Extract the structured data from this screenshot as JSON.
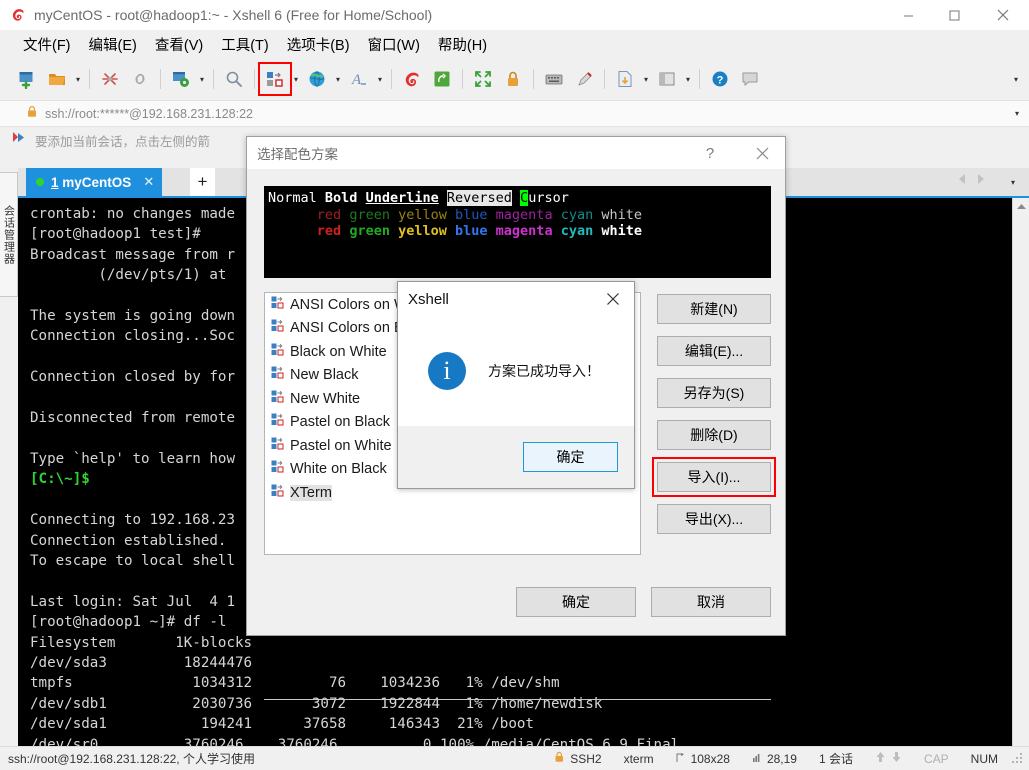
{
  "window": {
    "title": "myCentOS - root@hadoop1:~ - Xshell 6 (Free for Home/School)",
    "minimize": "−",
    "maximize": "□",
    "close": "✕"
  },
  "menubar": {
    "items": [
      {
        "label": "文件(F)",
        "name": "menu-file"
      },
      {
        "label": "编辑(E)",
        "name": "menu-edit"
      },
      {
        "label": "查看(V)",
        "name": "menu-view"
      },
      {
        "label": "工具(T)",
        "name": "menu-tools"
      },
      {
        "label": "选项卡(B)",
        "name": "menu-tabs"
      },
      {
        "label": "窗口(W)",
        "name": "menu-window"
      },
      {
        "label": "帮助(H)",
        "name": "menu-help"
      }
    ]
  },
  "toolbar": {
    "overflow_caret": "▾",
    "items": [
      "new-session-icon",
      "open-folder-icon",
      "dropdown-caret",
      "separator",
      "disconnect-icon",
      "link-icon",
      "separator",
      "properties-icon",
      "dropdown-caret",
      "separator",
      "find-icon",
      "separator",
      "color-scheme-icon",
      "dropdown-caret",
      "globe-icon",
      "dropdown-caret",
      "font-icon",
      "dropdown-caret",
      "separator",
      "xshell-icon",
      "xftp-icon",
      "separator",
      "fullscreen-icon",
      "lock-icon",
      "separator",
      "keyboard-icon",
      "highlight-icon",
      "separator",
      "transfer-icon",
      "dropdown-caret",
      "layout-icon",
      "dropdown-caret",
      "separator",
      "help-icon",
      "feedback-icon"
    ]
  },
  "address_bar": {
    "value": "ssh://root:******@192.168.231.128:22",
    "caret": "▾"
  },
  "hint_bar": {
    "text": "要添加当前会话，点击左侧的箭"
  },
  "session_strip": {
    "label": "会话管理器"
  },
  "tabbar": {
    "tab_index": "1",
    "tab_label": "myCentOS",
    "tab_close": "✕",
    "add_label": "+",
    "nav_left": "◀",
    "nav_right": "▶",
    "menu_caret": "▾"
  },
  "terminal": {
    "lines": [
      "crontab: no changes made",
      "[root@hadoop1 test]#",
      "Broadcast message from r",
      "        (/dev/pts/1) at",
      "",
      "The system is going down",
      "Connection closing...Soc",
      "",
      "Connection closed by for",
      "",
      "Disconnected from remote",
      "",
      "Type `help' to learn how"
    ],
    "prompt_local": "[C:\\~]$",
    "lines2": [
      "",
      "Connecting to 192.168.23",
      "Connection established.",
      "To escape to local shell",
      "",
      "Last login: Sat Jul  4 1",
      "[root@hadoop1 ~]# df -l",
      "Filesystem       1K-blocks",
      "/dev/sda3         18244476",
      "tmpfs              1034312         76    1034236   1% /dev/shm",
      "/dev/sdb1          2030736       3072    1922844   1% /home/newdisk",
      "/dev/sda1           194241      37658     146343  21% /boot",
      "/dev/sr0          3760246    3760246          0 100% /media/CentOS_6.9_Final"
    ],
    "prompt_last": "[root@hadoop1 ~]# ",
    "scroll_up": "▲"
  },
  "statusbar": {
    "left": "ssh://root@192.168.231.128:22, 个人学习使用",
    "protocol": "SSH2",
    "term_type": "xterm",
    "size": "108x28",
    "cursor": "28,19",
    "sessions": "1 会话",
    "arrow_up": "⬆",
    "arrow_down": "⬇",
    "cap": "CAP",
    "num": "NUM"
  },
  "dialog": {
    "title": "选择配色方案",
    "help": "?",
    "close": "✕",
    "preview": {
      "row1": [
        {
          "text": "Normal",
          "style": "pv-normal"
        },
        {
          "text": " ",
          "style": "pv-normal"
        },
        {
          "text": "Bold",
          "style": "pv-bold"
        },
        {
          "text": " ",
          "style": "pv-normal"
        },
        {
          "text": "Underline",
          "style": "pv-underline"
        },
        {
          "text": " ",
          "style": "pv-normal"
        },
        {
          "text": "Reversed",
          "style": "pv-reversed"
        },
        {
          "text": " ",
          "style": "pv-normal"
        },
        {
          "text": "C",
          "style": "pv-cursorchar"
        },
        {
          "text": "ursor",
          "style": "pv-normal"
        }
      ],
      "row2_prefix": "      ",
      "row2": [
        {
          "text": "red",
          "style": "pv-red"
        },
        {
          "text": "green",
          "style": "pv-green"
        },
        {
          "text": "yellow",
          "style": "pv-yellow"
        },
        {
          "text": "blue",
          "style": "pv-blue"
        },
        {
          "text": "magenta",
          "style": "pv-magenta"
        },
        {
          "text": "cyan",
          "style": "pv-cyan"
        },
        {
          "text": "white",
          "style": "pv-white"
        }
      ],
      "row3_prefix": "      ",
      "row3": [
        {
          "text": "red",
          "style": "pv-red-b"
        },
        {
          "text": "green",
          "style": "pv-green-b"
        },
        {
          "text": "yellow",
          "style": "pv-yellow-b"
        },
        {
          "text": "blue",
          "style": "pv-blue-b"
        },
        {
          "text": "magenta",
          "style": "pv-magenta-b"
        },
        {
          "text": "cyan",
          "style": "pv-cyan-b"
        },
        {
          "text": "white",
          "style": "pv-white-b"
        }
      ]
    },
    "schemes": [
      {
        "label": "ANSI Colors on White",
        "selected": false
      },
      {
        "label": "ANSI Colors on Black",
        "selected": false
      },
      {
        "label": "Black on White",
        "selected": false
      },
      {
        "label": "New Black",
        "selected": false
      },
      {
        "label": "New White",
        "selected": false
      },
      {
        "label": "Pastel on Black",
        "selected": false
      },
      {
        "label": "Pastel on White",
        "selected": false
      },
      {
        "label": "White on Black",
        "selected": false
      },
      {
        "label": "XTerm",
        "selected": true
      }
    ],
    "side_buttons": [
      {
        "label": "新建(N)",
        "name": "new-scheme-button",
        "highlight": false
      },
      {
        "label": "编辑(E)...",
        "name": "edit-scheme-button",
        "highlight": false
      },
      {
        "label": "另存为(S)",
        "name": "saveas-scheme-button",
        "highlight": false
      },
      {
        "label": "删除(D)",
        "name": "delete-scheme-button",
        "highlight": false
      },
      {
        "label": "导入(I)...",
        "name": "import-scheme-button",
        "highlight": true
      },
      {
        "label": "导出(X)...",
        "name": "export-scheme-button",
        "highlight": false
      }
    ],
    "ok_label": "确定",
    "cancel_label": "取消"
  },
  "msgbox": {
    "title": "Xshell",
    "close": "✕",
    "icon": "i",
    "message": "方案已成功导入！",
    "ok_label": "确定"
  },
  "colors": {
    "accent": "#1e90dd",
    "highlight_red": "#ff0000",
    "info_blue": "#1778c4",
    "terminal_bg": "#000000",
    "prompt_green": "#2fd52f"
  }
}
